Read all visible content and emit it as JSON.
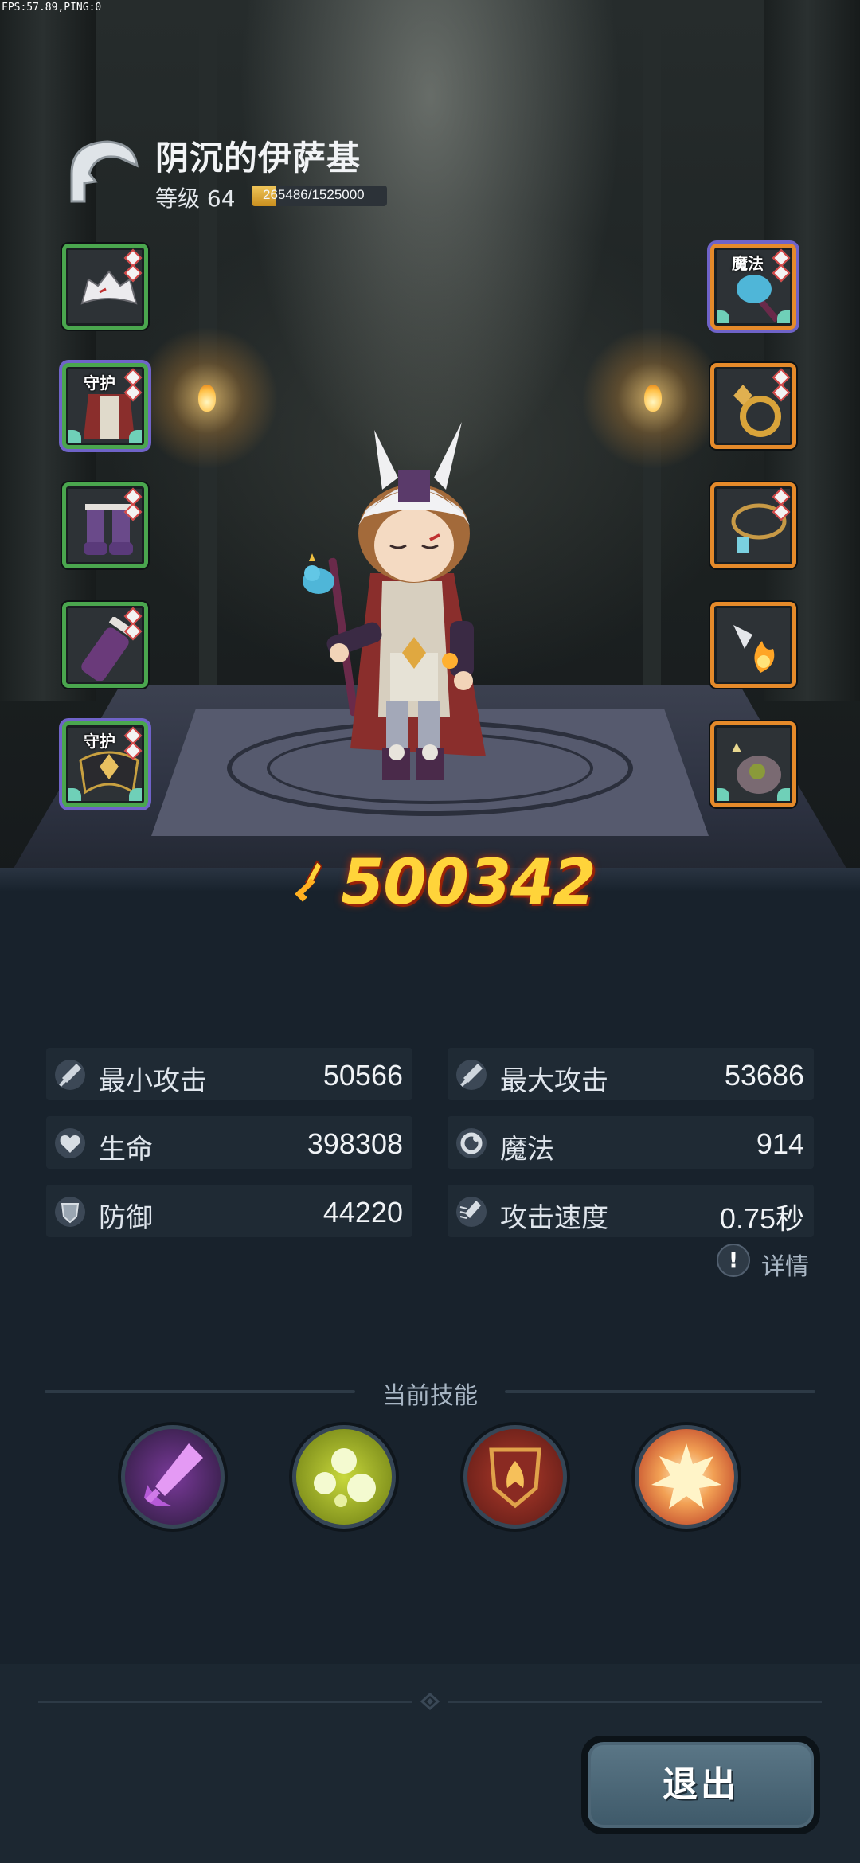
{
  "debug": {
    "fps_text": "FPS:57.89,PING:0"
  },
  "character": {
    "name": "阴沉的伊萨基",
    "level_label": "等级 64",
    "xp_text": "265486/1525000",
    "xp_fraction": 0.174
  },
  "equipment": {
    "left": [
      {
        "item": "helmet",
        "quality": "green",
        "tag": ""
      },
      {
        "item": "armor",
        "quality": "purple",
        "tag": "守护"
      },
      {
        "item": "boots",
        "quality": "green",
        "tag": ""
      },
      {
        "item": "bracer",
        "quality": "green",
        "tag": ""
      },
      {
        "item": "shoulder",
        "quality": "purple",
        "tag": "守护"
      }
    ],
    "right": [
      {
        "item": "staff",
        "quality": "purple",
        "tag": "魔法"
      },
      {
        "item": "ring",
        "quality": "orange",
        "tag": ""
      },
      {
        "item": "necklace",
        "quality": "orange",
        "tag": ""
      },
      {
        "item": "talisman",
        "quality": "orange",
        "tag": ""
      },
      {
        "item": "pet",
        "quality": "orange",
        "tag": ""
      }
    ]
  },
  "power": {
    "value": "500342",
    "icon": "sword-power-icon"
  },
  "stats": {
    "min_attack": {
      "label": "最小攻击",
      "value": "50566",
      "icon": "sword-icon"
    },
    "max_attack": {
      "label": "最大攻击",
      "value": "53686",
      "icon": "sword-icon"
    },
    "hp": {
      "label": "生命",
      "value": "398308",
      "icon": "heart-icon"
    },
    "mp": {
      "label": "魔法",
      "value": "914",
      "icon": "magic-icon"
    },
    "defense": {
      "label": "防御",
      "value": "44220",
      "icon": "shield-icon"
    },
    "attack_speed": {
      "label": "攻击速度",
      "value": "0.75秒",
      "icon": "speed-icon"
    }
  },
  "details_label": "详情",
  "skills": {
    "title": "当前技能",
    "items": [
      {
        "icon": "purple-blade-skill-icon",
        "color": "#b65ad8"
      },
      {
        "icon": "green-orbs-skill-icon",
        "color": "#a6b62c"
      },
      {
        "icon": "shield-burst-skill-icon",
        "color": "#8a2a22"
      },
      {
        "icon": "explosion-skill-icon",
        "color": "#e24a2c"
      }
    ]
  },
  "exit_label": "退出"
}
